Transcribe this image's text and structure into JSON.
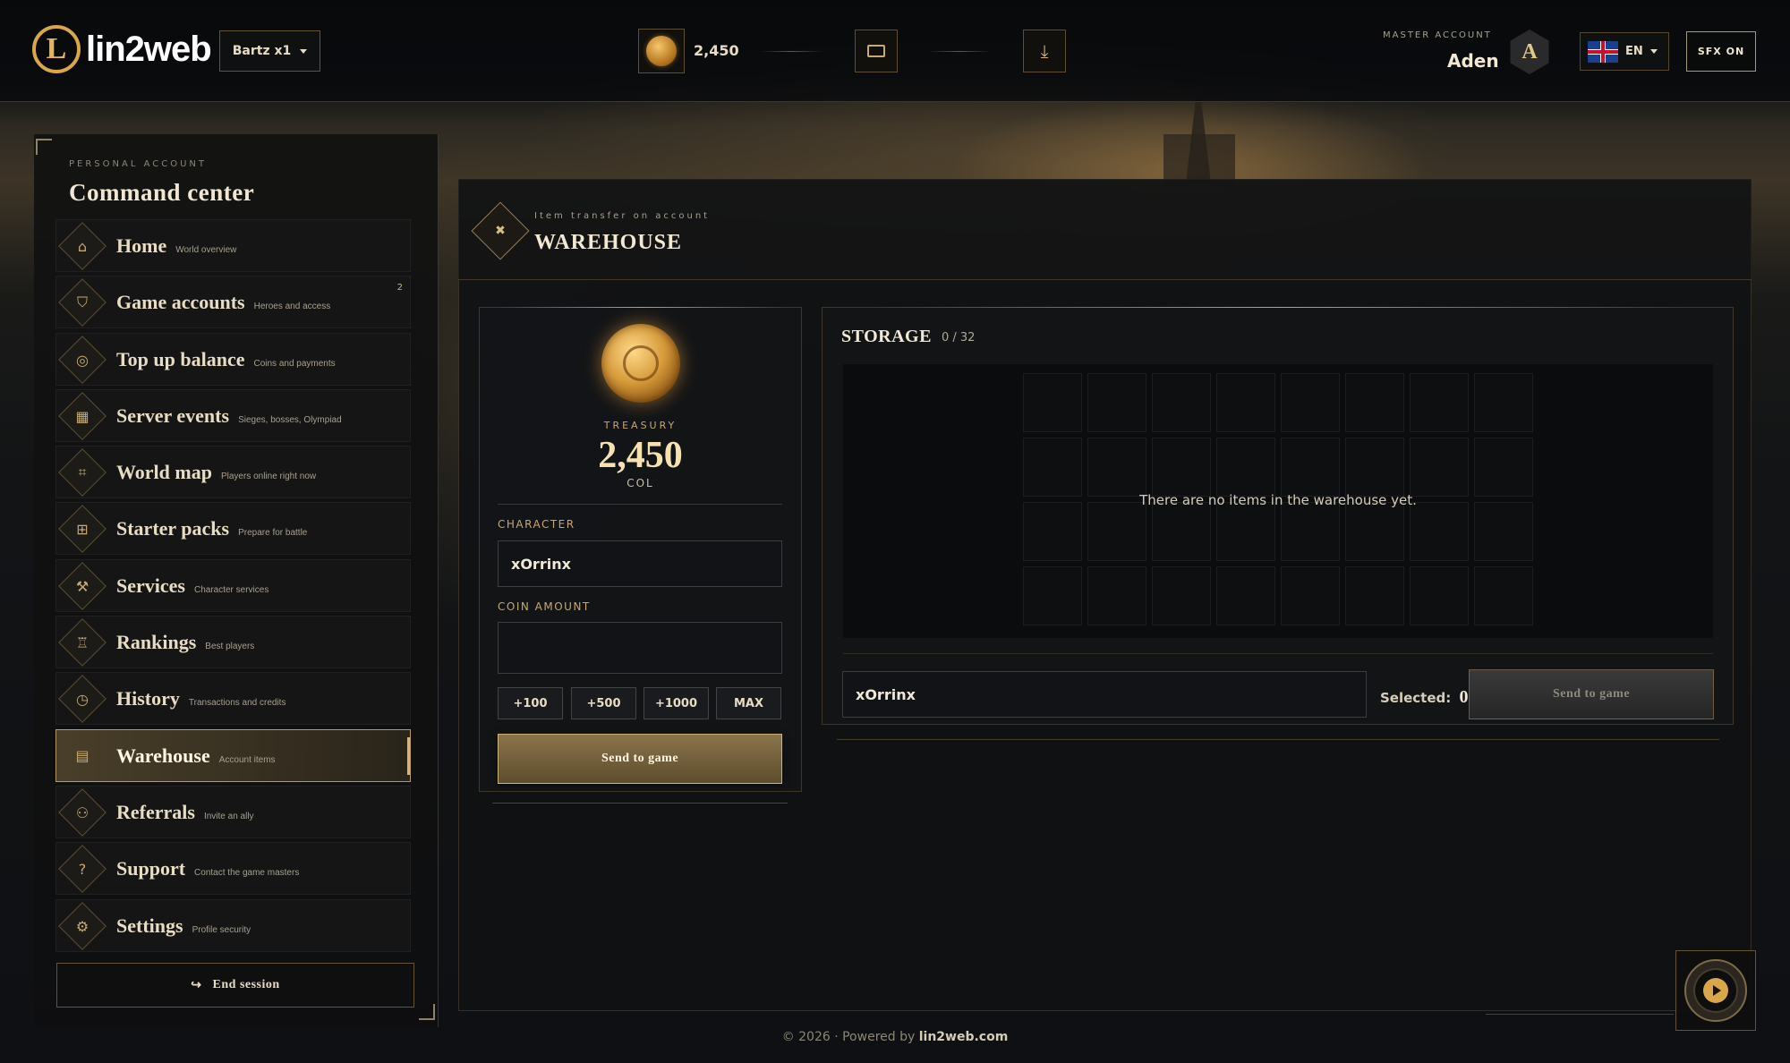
{
  "header": {
    "logo_text": "lin2web",
    "logo_letter": "L",
    "server": "Bartz x1",
    "coins": "2,450",
    "master_account_label": "MASTER ACCOUNT",
    "master_account_name": "Aden",
    "avatar_letter": "A",
    "language": "EN",
    "sfx": "SFX ON"
  },
  "sidebar": {
    "kicker": "PERSONAL ACCOUNT",
    "title": "Command center",
    "items": [
      {
        "label": "Home",
        "sub": "World overview",
        "icon": "home-icon"
      },
      {
        "label": "Game accounts",
        "sub": "Heroes and access",
        "icon": "shield-icon",
        "badge": "2"
      },
      {
        "label": "Top up balance",
        "sub": "Coins and payments",
        "icon": "coins-icon"
      },
      {
        "label": "Server events",
        "sub": "Sieges, bosses, Olympiad",
        "icon": "calendar-icon"
      },
      {
        "label": "World map",
        "sub": "Players online right now",
        "icon": "map-icon"
      },
      {
        "label": "Starter packs",
        "sub": "Prepare for battle",
        "icon": "gift-icon"
      },
      {
        "label": "Services",
        "sub": "Character services",
        "icon": "wrench-icon"
      },
      {
        "label": "Rankings",
        "sub": "Best players",
        "icon": "medal-icon"
      },
      {
        "label": "History",
        "sub": "Transactions and credits",
        "icon": "clock-icon"
      },
      {
        "label": "Warehouse",
        "sub": "Account items",
        "icon": "archive-icon",
        "active": true
      },
      {
        "label": "Referrals",
        "sub": "Invite an ally",
        "icon": "users-icon"
      },
      {
        "label": "Support",
        "sub": "Contact the game masters",
        "icon": "help-icon"
      },
      {
        "label": "Settings",
        "sub": "Profile security",
        "icon": "gear-icon"
      }
    ],
    "end_session": "End session"
  },
  "page": {
    "kicker": "Item transfer on account",
    "title": "WAREHOUSE"
  },
  "treasury": {
    "label": "TREASURY",
    "value": "2,450",
    "unit": "COL",
    "character_label": "CHARACTER",
    "character_value": "xOrrinx",
    "coin_amount_label": "COIN AMOUNT",
    "coin_amount_value": "",
    "chips": [
      "+100",
      "+500",
      "+1000",
      "MAX"
    ],
    "send_button": "Send to game"
  },
  "storage": {
    "title": "STORAGE",
    "count": "0 / 32",
    "empty_message": "There are no items in the warehouse yet.",
    "character_value": "xOrrinx",
    "selected_label": "Selected:",
    "selected_value": "0",
    "send_button": "Send to game"
  },
  "footer": {
    "text": "© 2026 · Powered by",
    "brand": "lin2web.com"
  },
  "colors": {
    "accent_gold": "#d9a64a",
    "background": "#0d0f12"
  }
}
